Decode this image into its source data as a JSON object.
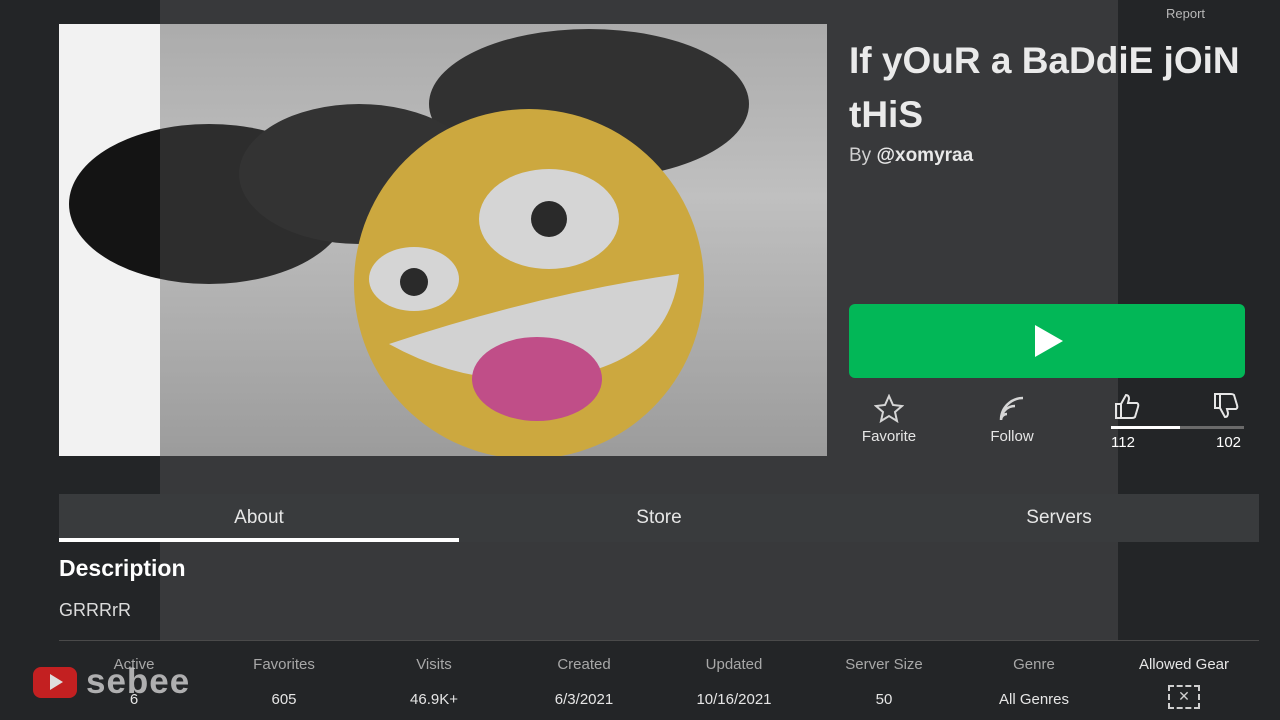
{
  "header": {
    "report_label": "Report"
  },
  "game": {
    "title": "If yOuR a BaDdiE jOiN tHiS",
    "by_prefix": "By",
    "creator": "@xomyraa"
  },
  "actions": {
    "favorite_label": "Favorite",
    "follow_label": "Follow",
    "upvotes": "112",
    "downvotes": "102",
    "like_ratio": 0.52
  },
  "tabs": [
    {
      "label": "About",
      "active": true
    },
    {
      "label": "Store",
      "active": false
    },
    {
      "label": "Servers",
      "active": false
    }
  ],
  "about": {
    "heading": "Description",
    "text": "GRRRrR"
  },
  "stats": [
    {
      "label": "Active",
      "value": "6"
    },
    {
      "label": "Favorites",
      "value": "605"
    },
    {
      "label": "Visits",
      "value": "46.9K+"
    },
    {
      "label": "Created",
      "value": "6/3/2021"
    },
    {
      "label": "Updated",
      "value": "10/16/2021"
    },
    {
      "label": "Server Size",
      "value": "50"
    },
    {
      "label": "Genre",
      "value": "All Genres"
    },
    {
      "label": "Allowed Gear",
      "icon": "no-gear-icon"
    }
  ],
  "watermark": {
    "text": "sebee",
    "icon": "youtube-icon"
  },
  "colors": {
    "play_button": "#02b757",
    "background": "#232527"
  }
}
